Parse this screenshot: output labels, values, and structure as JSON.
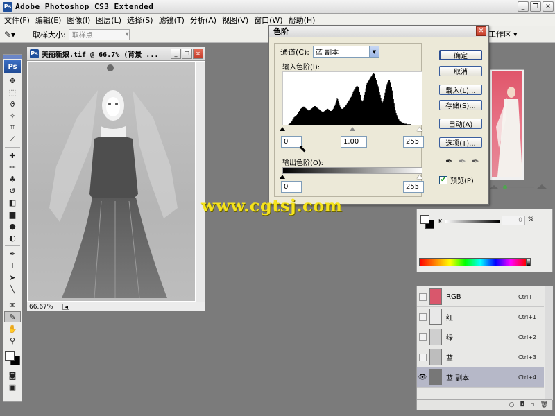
{
  "app": {
    "title": "Adobe Photoshop CS3 Extended",
    "badge": "Ps",
    "min": "_",
    "restore": "❐",
    "close": "✕"
  },
  "menu": [
    "文件(F)",
    "编辑(E)",
    "图像(I)",
    "图层(L)",
    "选择(S)",
    "滤镜(T)",
    "分析(A)",
    "视图(V)",
    "窗口(W)",
    "帮助(H)"
  ],
  "options": {
    "tool_icon": "✎▾",
    "sample_size_label": "取样大小:",
    "sample_size_value": "取样点",
    "workspace_label": "工作区",
    "workspace_arrow": "▾"
  },
  "toolbox": {
    "badge": "Ps",
    "tools": [
      {
        "name": "move-tool",
        "glyph": "✥"
      },
      {
        "name": "marquee-tool",
        "glyph": "⬚"
      },
      {
        "name": "lasso-tool",
        "glyph": "ϑ"
      },
      {
        "name": "magic-wand-tool",
        "glyph": "✧"
      },
      {
        "name": "crop-tool",
        "glyph": "⌗"
      },
      {
        "name": "slice-tool",
        "glyph": "⟋"
      },
      {
        "name": "healing-brush-tool",
        "glyph": "✚"
      },
      {
        "name": "brush-tool",
        "glyph": "✏"
      },
      {
        "name": "clone-stamp-tool",
        "glyph": "♣"
      },
      {
        "name": "history-brush-tool",
        "glyph": "↺"
      },
      {
        "name": "eraser-tool",
        "glyph": "◧"
      },
      {
        "name": "gradient-tool",
        "glyph": "▆"
      },
      {
        "name": "blur-tool",
        "glyph": "●"
      },
      {
        "name": "dodge-tool",
        "glyph": "◐"
      },
      {
        "name": "pen-tool",
        "glyph": "✒"
      },
      {
        "name": "type-tool",
        "glyph": "T"
      },
      {
        "name": "path-selection-tool",
        "glyph": "➤"
      },
      {
        "name": "line-tool",
        "glyph": "╲"
      },
      {
        "name": "notes-tool",
        "glyph": "✉"
      },
      {
        "name": "eyedropper-tool",
        "glyph": "✎"
      },
      {
        "name": "hand-tool",
        "glyph": "✋"
      },
      {
        "name": "zoom-tool",
        "glyph": "⚲"
      }
    ],
    "extra": [
      {
        "name": "quick-mask-icon",
        "glyph": "◙"
      },
      {
        "name": "screen-mode-icon",
        "glyph": "▣"
      }
    ]
  },
  "document": {
    "title": "美丽新娘.tif @ 66.7% (背景 ...",
    "zoom": "66.67%",
    "nav": "◄"
  },
  "levels": {
    "title": "色阶",
    "channel_label": "通道(C):",
    "channel_value": "蓝 副本",
    "input_label": "输入色阶(I):",
    "input_black": "0",
    "input_gamma": "1.00",
    "input_white": "255",
    "output_label": "输出色阶(O):",
    "output_black": "0",
    "output_white": "255",
    "histogram": [
      0,
      0,
      0,
      0,
      0,
      0,
      0,
      0,
      1,
      2,
      3,
      4,
      6,
      8,
      10,
      12,
      14,
      15,
      16,
      17,
      18,
      20,
      22,
      24,
      26,
      28,
      30,
      31,
      32,
      33,
      34,
      34,
      33,
      32,
      31,
      30,
      29,
      28,
      27,
      27,
      28,
      29,
      30,
      31,
      32,
      33,
      34,
      35,
      35,
      34,
      33,
      32,
      31,
      30,
      29,
      28,
      27,
      26,
      25,
      24,
      24,
      25,
      26,
      27,
      28,
      29,
      30,
      30,
      29,
      28,
      27,
      26,
      26,
      27,
      28,
      30,
      32,
      35,
      38,
      42,
      46,
      50,
      48,
      44,
      40,
      36,
      33,
      31,
      30,
      30,
      31,
      32,
      33,
      34,
      36,
      38,
      40,
      42,
      44,
      46,
      48,
      50,
      52,
      55,
      58,
      61,
      64,
      66,
      68,
      70,
      72,
      73,
      72,
      70,
      66,
      61,
      56,
      50,
      46,
      44,
      46,
      50,
      56,
      62,
      68,
      74,
      78,
      80,
      82,
      84,
      86,
      88,
      90,
      92,
      94,
      95,
      96,
      95,
      92,
      88,
      84,
      80,
      76,
      72,
      68,
      62,
      56,
      50,
      45,
      42,
      44,
      48,
      54,
      60,
      66,
      72,
      76,
      80,
      82,
      84,
      83,
      80,
      76,
      70,
      64,
      56,
      48,
      40,
      33,
      27,
      22,
      18,
      15,
      12,
      10,
      8,
      7,
      6,
      5,
      4,
      4,
      3,
      3,
      2,
      2,
      2,
      2,
      1,
      1,
      1,
      1,
      1,
      1,
      0,
      0,
      0,
      0,
      0,
      0,
      0,
      0,
      0,
      0,
      0,
      0,
      0,
      0,
      0,
      0
    ],
    "buttons": {
      "ok": "确定",
      "cancel": "取消",
      "load": "载入(L)...",
      "save": "存储(S)...",
      "auto": "自动(A)",
      "options": "选项(T)..."
    },
    "preview_label": "预览(P)",
    "preview_checked": true,
    "close_glyph": "✕"
  },
  "watermark": "www.cgtsj.com",
  "color_panel": {
    "k_label": "K",
    "value": "0",
    "unit": "%"
  },
  "channels": [
    {
      "name": "RGB",
      "shortcut": "Ctrl+~",
      "thumb_color": "#d9576c",
      "visible": false
    },
    {
      "name": "红",
      "shortcut": "Ctrl+1",
      "thumb_color": "#e8e8e8",
      "visible": false
    },
    {
      "name": "绿",
      "shortcut": "Ctrl+2",
      "thumb_color": "#cfcfcf",
      "visible": false
    },
    {
      "name": "蓝",
      "shortcut": "Ctrl+3",
      "thumb_color": "#bdbdbd",
      "visible": false
    },
    {
      "name": "蓝 副本",
      "shortcut": "Ctrl+4",
      "thumb_color": "#777777",
      "visible": true
    }
  ],
  "channels_footer": [
    "○",
    "◘",
    "▫",
    "🗑"
  ]
}
